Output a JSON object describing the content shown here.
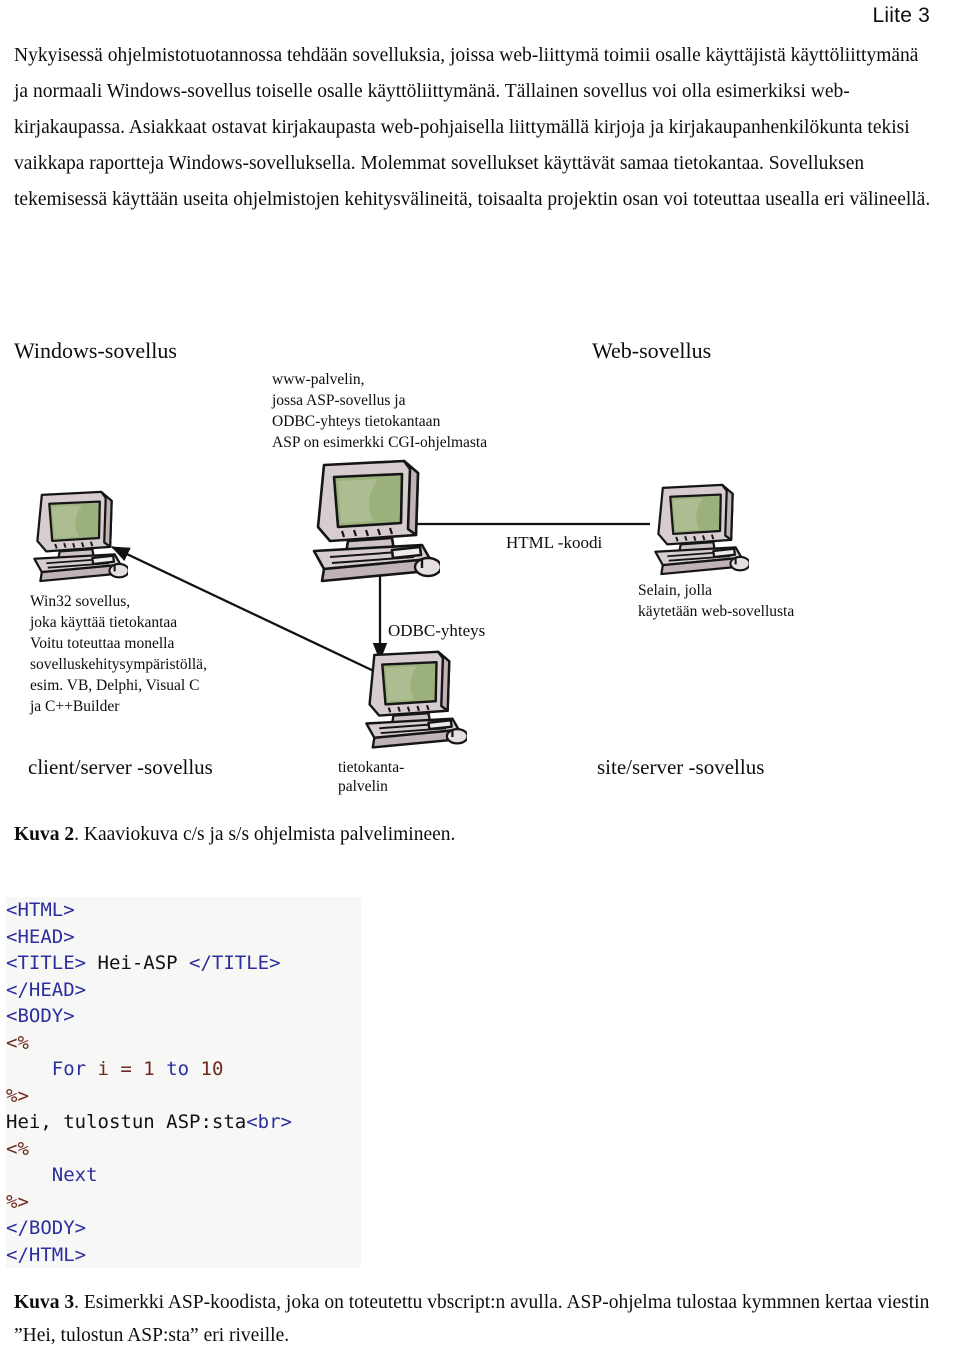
{
  "header": {
    "appendix_label": "Liite 3"
  },
  "intro": {
    "paragraph": "Nykyisessä ohjelmistotuotannossa tehdään sovelluksia, joissa web-liittymä toimii osalle käyttäjistä käyttöliittymänä ja normaali Windows-sovellus toiselle osalle käyttöliittymänä. Tällainen sovellus voi olla esimerkiksi web-kirjakaupassa. Asiakkaat ostavat kirjakaupasta web-pohjaisella liittymällä kirjoja ja kirjakaupanhenkilökunta tekisi vaikkapa raportteja Windows-sovelluksella. Molemmat sovellukset käyttävät samaa tietokantaa. Sovelluksen tekemisessä käyttään useita ohjelmistojen kehitysvälineitä, toisaalta projektin osan voi toteuttaa usealla eri välineellä."
  },
  "figure": {
    "title_left": "Windows-sovellus",
    "title_right": "Web-sovellus",
    "footer_left": "client/server -sovellus",
    "footer_right": "site/server -sovellus",
    "note_www_server": "www-palvelin,\njossa ASP-sovellus ja\nODBC-yhteys tietokantaan\nASP on esimerkki CGI-ohjelmasta",
    "note_win32": "Win32 sovellus,\njoka käyttää tietokantaa\nVoitu toteuttaa monella\nsovelluskehitysympäristöllä,\nesim. VB, Delphi, Visual C\nja C++Builder",
    "note_browser": "Selain, jolla\nkäytetään web-sovellusta",
    "arrow_label_html": "HTML -koodi",
    "arrow_label_odbc": "ODBC-yhteys",
    "node_db_label": "tietokanta-\npalvelin",
    "colors": {
      "screen_green": "#9cb07c",
      "case_grey": "#d7cdcf",
      "outline": "#1a1a1a"
    }
  },
  "captions": {
    "kuva2_number": "Kuva 2",
    "kuva2_text": ". Kaaviokuva c/s ja s/s ohjelmista palvelimineen.",
    "kuva3_number": "Kuva 3",
    "kuva3_text": ". Esimerkki ASP-koodista, joka on toteutettu vbscript:n avulla. ASP-ohjelma tulostaa kymmnen kertaa viestin ”Hei, tulostun ASP:sta” eri riveille."
  },
  "code": {
    "language": "asp-vbscript",
    "colors": {
      "tag": "#2b2f9e",
      "asp_delimiter": "#6e2a1e",
      "keyword": "#2b2f9e",
      "number": "#6e2a1e",
      "plain": "#111111"
    },
    "lines": [
      [
        {
          "t": "<HTML>",
          "c": "tag"
        }
      ],
      [
        {
          "t": "<HEAD>",
          "c": "tag"
        }
      ],
      [
        {
          "t": "<TITLE>",
          "c": "tag"
        },
        {
          "t": " Hei-ASP ",
          "c": "plain"
        },
        {
          "t": "</TITLE>",
          "c": "tag"
        }
      ],
      [
        {
          "t": "</HEAD>",
          "c": "tag"
        }
      ],
      [
        {
          "t": "<BODY>",
          "c": "tag"
        }
      ],
      [
        {
          "t": "<%",
          "c": "asp"
        }
      ],
      [
        {
          "t": "    ",
          "c": "plain"
        },
        {
          "t": "For",
          "c": "kw"
        },
        {
          "t": " ",
          "c": "plain"
        },
        {
          "t": "i = 1",
          "c": "num"
        },
        {
          "t": " ",
          "c": "plain"
        },
        {
          "t": "to",
          "c": "kw"
        },
        {
          "t": " ",
          "c": "plain"
        },
        {
          "t": "10",
          "c": "num"
        }
      ],
      [
        {
          "t": "%>",
          "c": "asp"
        }
      ],
      [
        {
          "t": "Hei, tulostun ASP:sta",
          "c": "plain"
        },
        {
          "t": "<br>",
          "c": "tag"
        }
      ],
      [
        {
          "t": "<%",
          "c": "asp"
        }
      ],
      [
        {
          "t": "    ",
          "c": "plain"
        },
        {
          "t": "Next",
          "c": "kw"
        }
      ],
      [
        {
          "t": "%>",
          "c": "asp"
        }
      ],
      [
        {
          "t": "</BODY>",
          "c": "tag"
        }
      ],
      [
        {
          "t": "</HTML>",
          "c": "tag"
        }
      ]
    ]
  }
}
